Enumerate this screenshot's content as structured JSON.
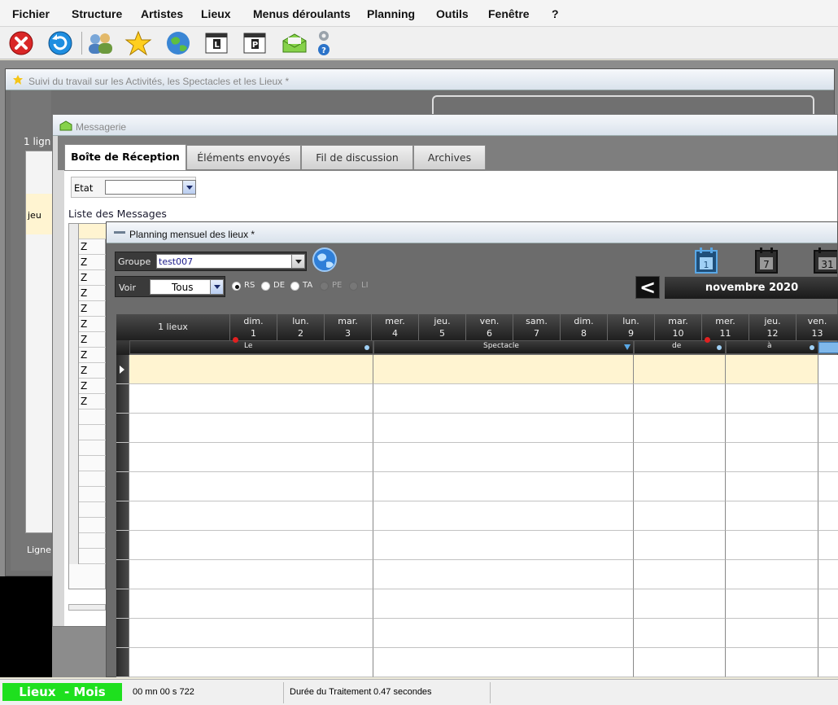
{
  "menu": [
    "Fichier",
    "Structure",
    "Artistes",
    "Lieux",
    "Menus déroulants",
    "Planning",
    "Outils",
    "Fenêtre",
    "?"
  ],
  "toolbar": {
    "icons": [
      "close-red-icon",
      "refresh-blue-icon",
      "users-icon",
      "star-icon",
      "globe-icon",
      "l-document-icon",
      "p-document-icon",
      "envelope-green-icon",
      "settings-help-icon"
    ],
    "side_letters": {
      "l": "L",
      "p": "P"
    },
    "help_glyph": "?"
  },
  "win1": {
    "title": "Suivi du travail sur les Activités, les Spectacles et les Lieux *",
    "row_count_label": "1 lign",
    "row_text": "jeu",
    "ligne_label": "Ligne"
  },
  "messagerie": {
    "title": "Messagerie",
    "tabs": [
      "Boîte de Réception",
      "Éléments envoyés",
      "Fil de discussion",
      "Archives"
    ],
    "active_tab": 0,
    "etat_label": "Etat",
    "etat_value": "",
    "list_title": "Liste des Messages",
    "rows": [
      "Z",
      "Z",
      "Z",
      "Z",
      "Z",
      "Z",
      "Z",
      "Z",
      "Z",
      "Z",
      "Z"
    ]
  },
  "planning": {
    "title": "Planning mensuel des lieux *",
    "groupe_label": "Groupe",
    "groupe_value": "test007",
    "voir_label": "Voir",
    "voir_value": "Tous",
    "radios": [
      {
        "label": "RS",
        "checked": true
      },
      {
        "label": "DE",
        "checked": false
      },
      {
        "label": "TA",
        "checked": false
      },
      {
        "label": "PE",
        "checked": false,
        "disabled": true
      },
      {
        "label": "LI",
        "checked": false,
        "disabled": true
      }
    ],
    "calendar_icons": [
      "1",
      "7",
      "31"
    ],
    "month": "novembre 2020",
    "prev_glyph": "<",
    "lieux_label": "1 lieux",
    "days": [
      {
        "d": "dim.",
        "n": "1"
      },
      {
        "d": "lun.",
        "n": "2"
      },
      {
        "d": "mar.",
        "n": "3"
      },
      {
        "d": "mer.",
        "n": "4"
      },
      {
        "d": "jeu.",
        "n": "5"
      },
      {
        "d": "ven.",
        "n": "6"
      },
      {
        "d": "sam.",
        "n": "7"
      },
      {
        "d": "dim.",
        "n": "8"
      },
      {
        "d": "lun.",
        "n": "9"
      },
      {
        "d": "mar.",
        "n": "10"
      },
      {
        "d": "mer.",
        "n": "11"
      },
      {
        "d": "jeu.",
        "n": "12"
      },
      {
        "d": "ven.",
        "n": "13"
      }
    ],
    "columns": [
      "Le",
      "Spectacle",
      "de",
      "à"
    ]
  },
  "status": {
    "mode": "Lieux  - Mois",
    "timer": "00 mn 00 s 722",
    "duration_label": "Durée du Traitement",
    "duration_value": "0.47 secondes"
  },
  "colors": {
    "status_green": "#1ee01e",
    "selected_row": "#fff4d1",
    "accent_blue": "#1f6fd1"
  }
}
